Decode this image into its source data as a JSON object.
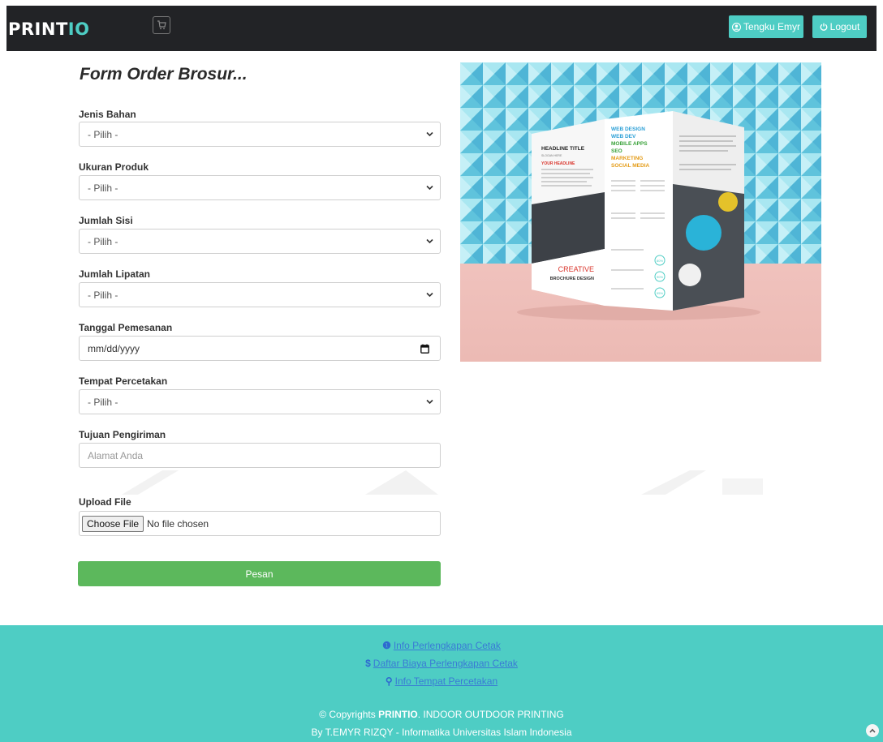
{
  "nav": {
    "brand_main": "PRINT",
    "brand_accent": "IO",
    "cart_icon": "cart-icon",
    "user_label": "Tengku Emyr",
    "logout_label": "Logout"
  },
  "form": {
    "title": "Form Order Brosur...",
    "fields": {
      "jenis_bahan": {
        "label": "Jenis Bahan",
        "value": "- Pilih -"
      },
      "ukuran_produk": {
        "label": "Ukuran Produk",
        "value": "- Pilih -"
      },
      "jumlah_sisi": {
        "label": "Jumlah Sisi",
        "value": "- Pilih -"
      },
      "jumlah_lipatan": {
        "label": "Jumlah Lipatan",
        "value": "- Pilih -"
      },
      "tanggal_pemesanan": {
        "label": "Tanggal Pemesanan",
        "placeholder": "mm/dd/yyyy"
      },
      "tempat_percetakan": {
        "label": "Tempat Percetakan",
        "value": "- Pilih -"
      },
      "tujuan_pengiriman": {
        "label": "Tujuan Pengiriman",
        "placeholder": "Alamat Anda"
      },
      "upload_file": {
        "label": "Upload File",
        "button": "Choose File",
        "status": "No file chosen"
      }
    },
    "submit_label": "Pesan"
  },
  "brochure": {
    "headline_title": "HEADLINE TITLE",
    "slogan": "SLOGAN HERE",
    "your_headline": "YOUR HEADLINE",
    "services": [
      "WEB DESIGN",
      "WEB DEV",
      "MOBILE APPS",
      "SEO",
      "MARKETING",
      "SOCIAL MEDIA"
    ],
    "creative": "CREATIVE",
    "brochure_design": "BROCHURE DESIGN",
    "percents": [
      "80%",
      "90%",
      "95%"
    ]
  },
  "footer": {
    "links": [
      {
        "icon": "info-icon",
        "glyph": "❶",
        "label": "Info Perlengkapan Cetak"
      },
      {
        "icon": "dollar-icon",
        "glyph": "$",
        "label": "Daftar Biaya Perlengkapan Cetak"
      },
      {
        "icon": "map-marker-icon",
        "glyph": "⚲",
        "label": "Info Tempat Percetakan"
      }
    ],
    "copyright_prefix": "© Copyrights ",
    "copyright_brand": "PRINTIO",
    "copyright_suffix": ". INDOOR OUTDOOR PRINTING",
    "credit": "By T.EMYR RIZQY - Informatika Universitas Islam Indonesia"
  },
  "colors": {
    "navbar": "#222326",
    "accent": "#4ecdc4",
    "submit": "#5cb85c",
    "link": "#3a7bd5"
  }
}
